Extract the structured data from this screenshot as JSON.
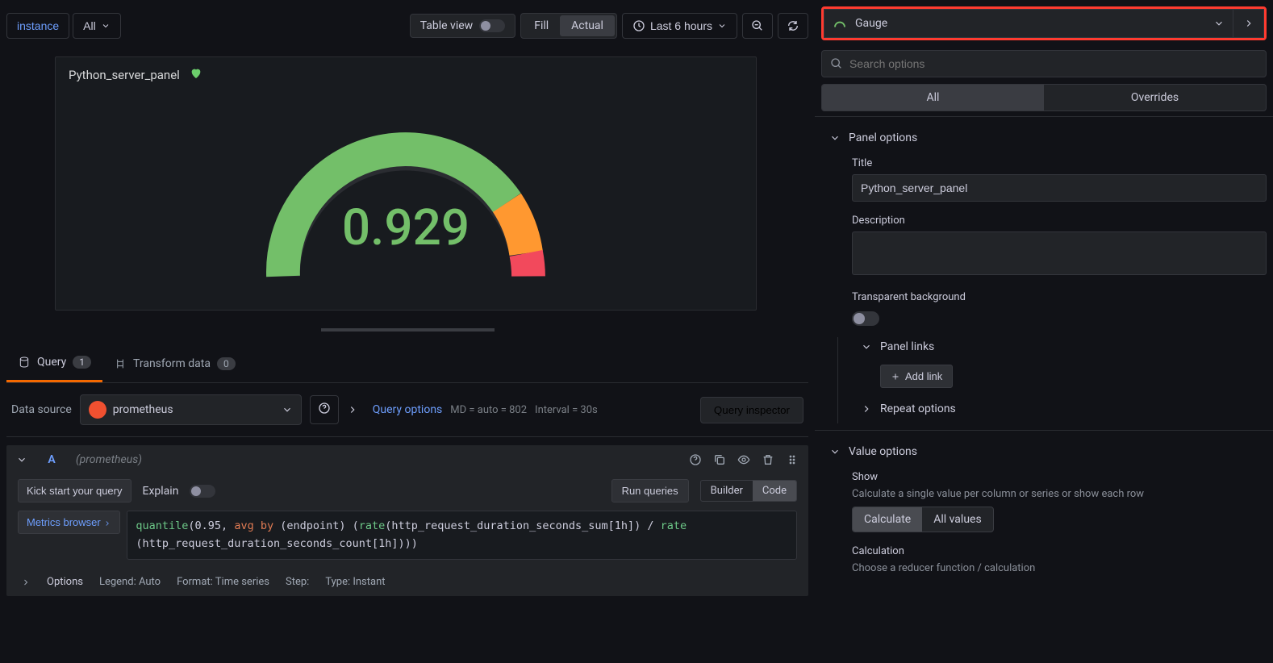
{
  "toolbar": {
    "instance_label": "instance",
    "all_label": "All",
    "table_view_label": "Table view",
    "fill_label": "Fill",
    "actual_label": "Actual",
    "time_range": "Last 6 hours"
  },
  "panel": {
    "title": "Python_server_panel",
    "gauge_value": "0.929"
  },
  "tabs": {
    "query_label": "Query",
    "query_count": "1",
    "transform_label": "Transform data",
    "transform_count": "0"
  },
  "query": {
    "ds_label": "Data source",
    "ds_name": "prometheus",
    "options_label": "Query options",
    "md_meta": "MD = auto = 802",
    "interval_meta": "Interval = 30s",
    "inspector_label": "Query inspector",
    "q_name": "A",
    "q_source": "(prometheus)",
    "kick_label": "Kick start your query",
    "explain_label": "Explain",
    "run_label": "Run queries",
    "builder_label": "Builder",
    "code_label": "Code",
    "metrics_browser_label": "Metrics browser",
    "code_fn1": "quantile",
    "code_p1": "(0.95, ",
    "code_kw1": "avg by",
    "code_p2": " (endpoint) (",
    "code_fn2": "rate",
    "code_p3": "(http_request_duration_seconds_sum[1h]) / ",
    "code_fn3": "rate",
    "code_p4": "(http_request_duration_seconds_count[1h])))",
    "opts_label": "Options",
    "legend_label": "Legend: Auto",
    "format_label": "Format: Time series",
    "step_label": "Step:",
    "type_label": "Type: Instant"
  },
  "sidebar": {
    "viz_name": "Gauge",
    "search_placeholder": "Search options",
    "tab_all": "All",
    "tab_overrides": "Overrides",
    "panel_options_label": "Panel options",
    "title_label": "Title",
    "title_value": "Python_server_panel",
    "description_label": "Description",
    "transparent_label": "Transparent background",
    "panel_links_label": "Panel links",
    "add_link_label": "Add link",
    "repeat_options_label": "Repeat options",
    "value_options_label": "Value options",
    "show_label": "Show",
    "show_help": "Calculate a single value per column or series or show each row",
    "calculate_label": "Calculate",
    "all_values_label": "All values",
    "calculation_label": "Calculation",
    "calculation_help": "Choose a reducer function / calculation"
  }
}
